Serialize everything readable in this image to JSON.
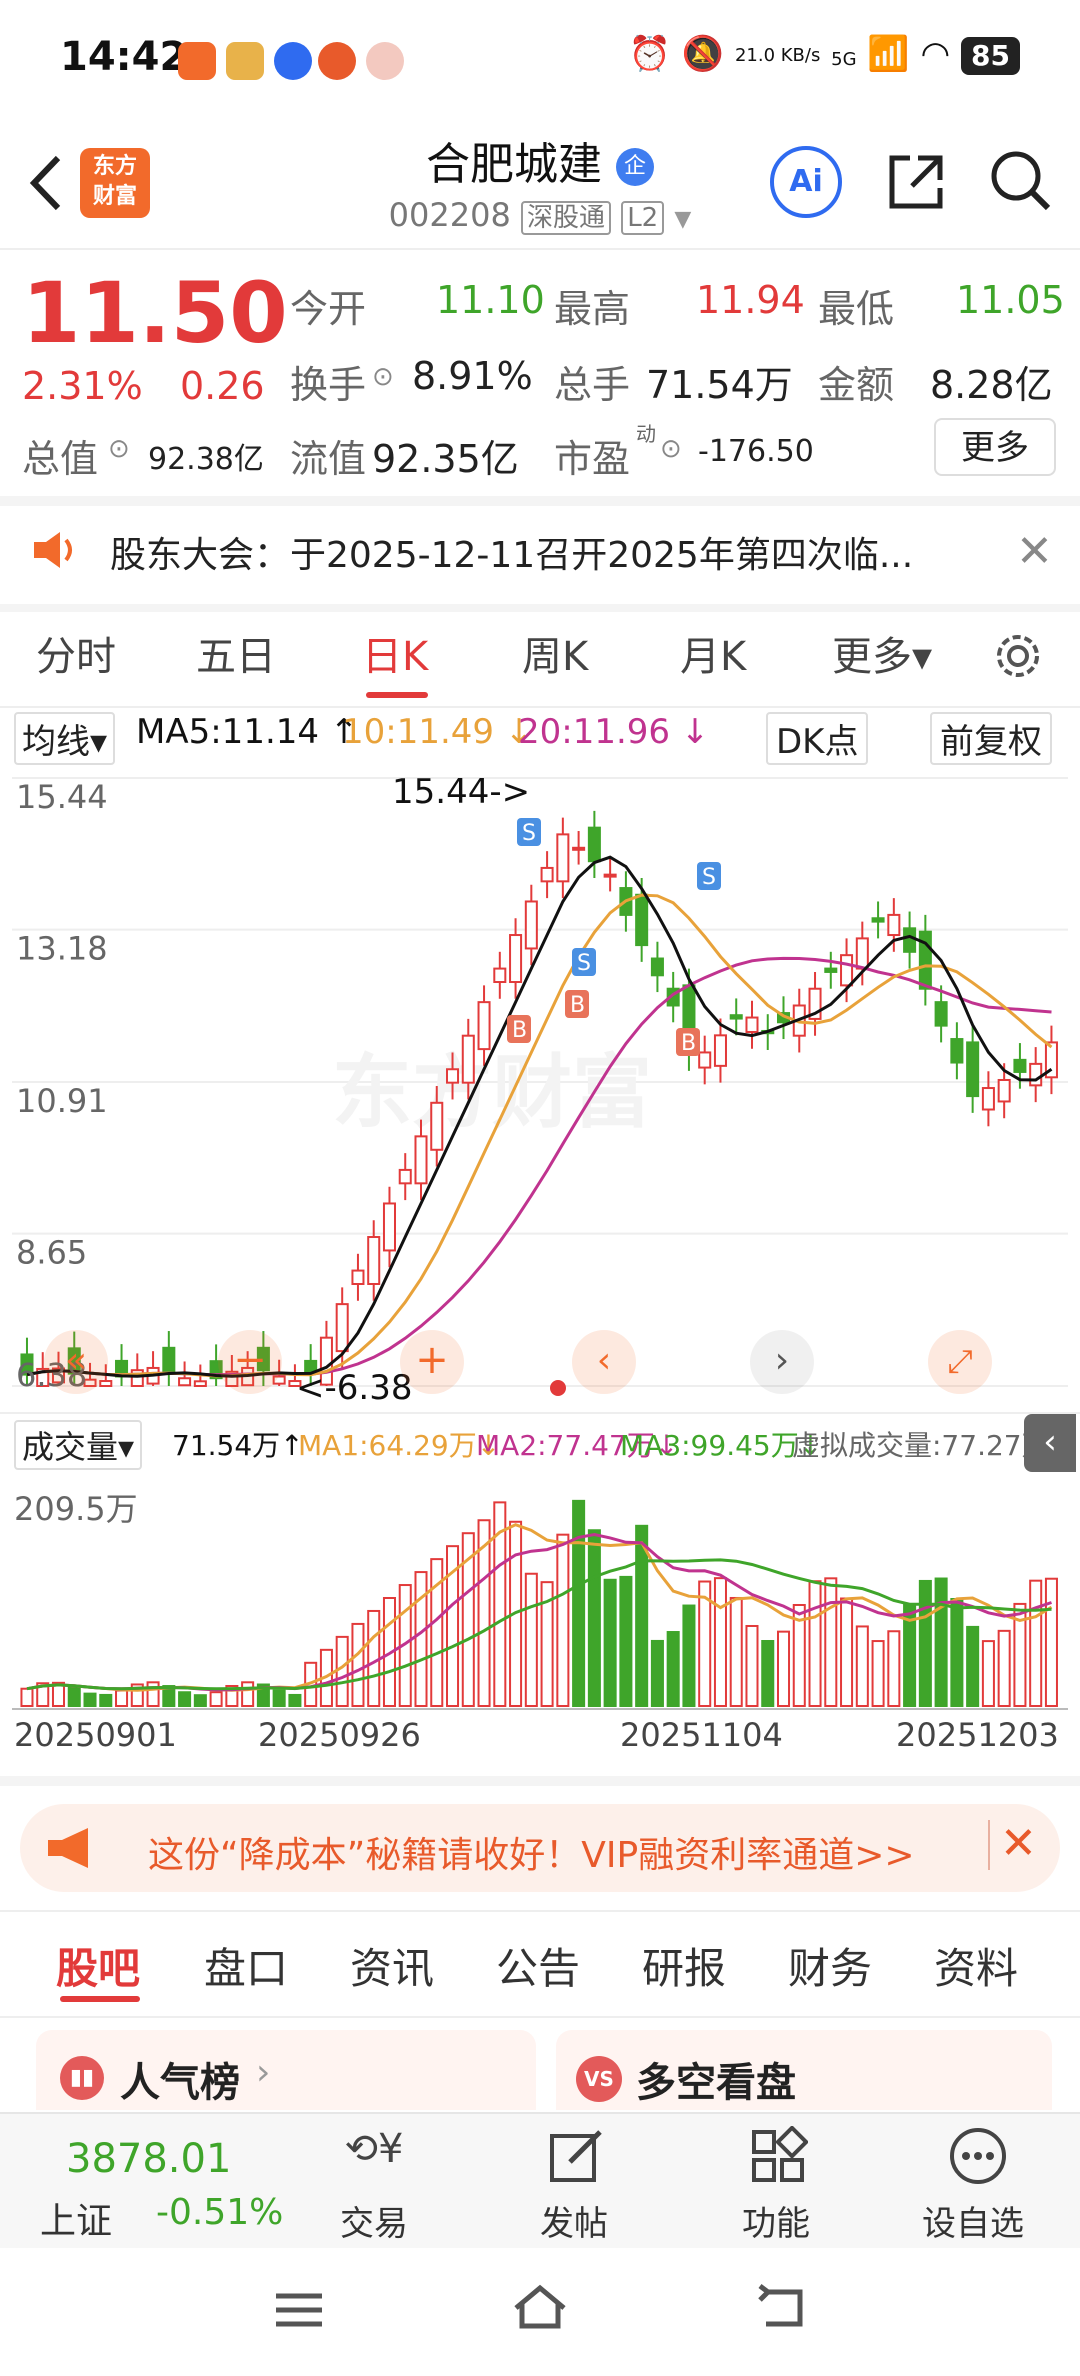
{
  "status_bar": {
    "time": "14:42",
    "net_speed": "21.0 KB/s",
    "network": "5G",
    "battery": "85"
  },
  "header": {
    "back_icon": "chevron-left-icon",
    "brand_logo": "东方\n财富",
    "stock_name": "合肥城建",
    "badge": "企",
    "stock_code": "002208",
    "exchange_tag": "深股通",
    "level_tag": "L2"
  },
  "quote": {
    "price": "11.50",
    "change_pct": "2.31%",
    "change": "0.26",
    "open_label": "今开",
    "open": "11.10",
    "high_label": "最高",
    "high": "11.94",
    "low_label": "最低",
    "low": "11.05",
    "turnover_label": "换手",
    "turnover": "8.91%",
    "volume_label": "总手",
    "volume": "71.54万",
    "amount_label": "金额",
    "amount": "8.28亿",
    "mktcap_label": "总值",
    "mktcap": "92.38亿",
    "float_label": "流值",
    "float": "92.35亿",
    "pe_label": "市盈",
    "pe_sup": "动",
    "pe": "-176.50",
    "more_button": "更多"
  },
  "notice": {
    "text": "股东大会：于2025-12-11召开2025年第四次临..."
  },
  "period_tabs": [
    "分时",
    "五日",
    "日K",
    "周K",
    "月K",
    "更多▾"
  ],
  "active_tab": "日K",
  "chart_toolbar": {
    "ma_select": "均线▾",
    "ma5": "MA5:11.14 ↑",
    "ma10": "10:11.49 ↓",
    "ma20": "20:11.96 ↓",
    "dk_button": "DK点",
    "adjust_button": "前复权"
  },
  "price_axis": [
    "15.44",
    "13.18",
    "10.91",
    "8.65",
    "6.38"
  ],
  "high_marker": "15.44->",
  "low_marker": "<-6.38",
  "volume_toolbar": {
    "select": "成交量▾",
    "vol": "71.54万↑",
    "ma1": "MA1:64.29万↓",
    "ma2": "MA2:77.47万↓",
    "ma3": "MA3:99.45万↓",
    "virtual": "虚拟成交量:77.27万"
  },
  "volume_axis_max": "209.5万",
  "date_labels": [
    "20250901",
    "20250926",
    "20251104",
    "20251203"
  ],
  "promo": {
    "text": "这份“降成本”秘籍请收好！VIP融资利率通道>>"
  },
  "section_tabs": [
    "股吧",
    "盘口",
    "资讯",
    "公告",
    "研报",
    "财务",
    "资料"
  ],
  "cards": [
    {
      "title": "人气榜",
      "icon": "bar-chart-icon"
    },
    {
      "title": "多空看盘",
      "icon": "vs-icon"
    }
  ],
  "bottom_bar": {
    "index_value": "3878.01",
    "index_name": "上证",
    "index_change": "-0.51%",
    "items": [
      "交易",
      "发帖",
      "功能",
      "设自选"
    ]
  },
  "colors": {
    "red": "#e23a3a",
    "green": "#3fa52a",
    "orange": "#f26a2b",
    "ma5": "#111111",
    "ma10": "#e8a23a",
    "ma20": "#c0338f",
    "blue": "#2f6bf0"
  },
  "chart_data": {
    "type": "candlestick",
    "y_ticks": [
      15.44,
      13.18,
      10.91,
      8.65,
      6.38
    ],
    "ylim": [
      6.38,
      15.44
    ],
    "x_labels": [
      "20250901",
      "20250926",
      "20251104",
      "20251203"
    ],
    "last_close": 11.5,
    "high": 15.44,
    "low": 6.38,
    "volume_max": "209.5万"
  }
}
